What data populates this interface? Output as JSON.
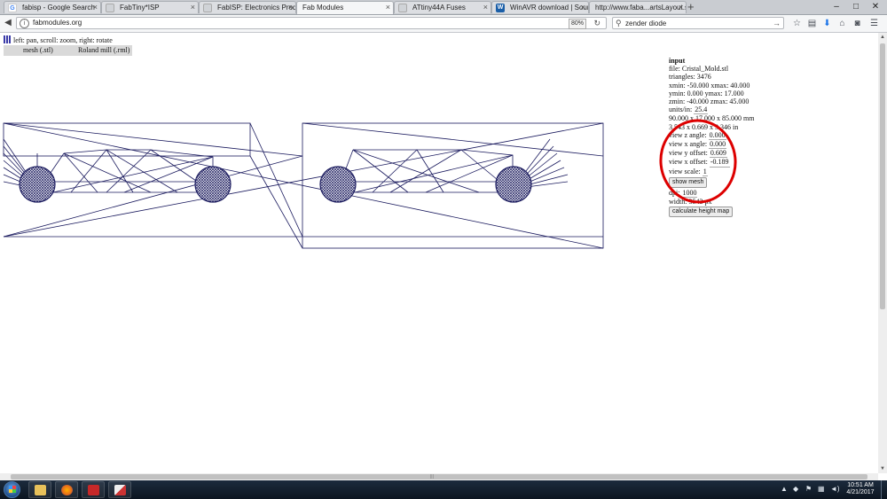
{
  "browser": {
    "tabs": [
      {
        "label": "fabisp - Google Search",
        "icon": "google-icon",
        "icon_color": "#4285f4",
        "active": false
      },
      {
        "label": "FabTiny*ISP",
        "icon": "page-icon",
        "icon_color": "#9aa0a6",
        "active": false
      },
      {
        "label": "FabISP: Electronics Production",
        "icon": "page-icon",
        "icon_color": "#9aa0a6",
        "active": false
      },
      {
        "label": "Fab Modules",
        "icon": "page-icon",
        "icon_color": "#9aa0a6",
        "active": true
      },
      {
        "label": "ATtiny44A Fuses",
        "icon": "page-icon",
        "icon_color": "#9aa0a6",
        "active": false
      },
      {
        "label": "WinAVR download | Sourc...",
        "icon": "sourceforge-icon",
        "icon_color": "#ff6600",
        "active": false
      },
      {
        "label": "http://www.faba...artsLayout.svg",
        "icon": "page-icon",
        "icon_color": "#9aa0a6",
        "active": false
      }
    ],
    "window_controls": {
      "minimize": "–",
      "maximize": "□",
      "close": "✕"
    },
    "url": "fabmodules.org",
    "zoom": "80%",
    "search_value": "zender diode",
    "search_placeholder": "Search"
  },
  "page": {
    "hint": "left: pan, scroll: zoom, right: rotate",
    "menu": [
      "mesh (.stl)",
      "Roland mill (.rml)"
    ],
    "panel": {
      "heading": "input",
      "file": "file: Cristal_Mold.stl",
      "triangles": "triangles: 3476",
      "xminmax": "xmin: -50.000 xmax: 40.000",
      "yminmax": "ymin: 0.000 ymax: 17.000",
      "zminmax": "zmin: -40.000 zmax: 45.000",
      "units_label": "units/in:",
      "units_value": "25.4",
      "size_mm": "90.000 x 17.000 x 85.000 mm",
      "size_in": "3.543 x 0.669 x 3.346 in",
      "view_z_label": "view z angle:",
      "view_z_value": "0.000",
      "view_x_label": "view x angle:",
      "view_x_value": "0.000",
      "view_y_off_label": "view y offset:",
      "view_y_off_value": "0.609",
      "view_x_off_label": "view x offset:",
      "view_x_off_value": "-0.189",
      "view_scale_label": "view scale:",
      "view_scale_value": "1",
      "show_mesh": "show mesh",
      "dpi_label": "dpi:",
      "dpi_value": "1000",
      "width_text": "width: 3543 px",
      "calc_button": "calculate height map"
    },
    "annotation_color": "#dd0000",
    "mesh_color": "#1a1a5e"
  },
  "taskbar": {
    "apps": [
      {
        "name": "file-explorer",
        "color": "#e8c15a"
      },
      {
        "name": "firefox",
        "color": "#e56a1c"
      },
      {
        "name": "filezilla",
        "color": "#c62828"
      },
      {
        "name": "app-4",
        "color": "#d9d9d9"
      }
    ],
    "time": "10:51 AM",
    "date": "4/21/2017"
  }
}
